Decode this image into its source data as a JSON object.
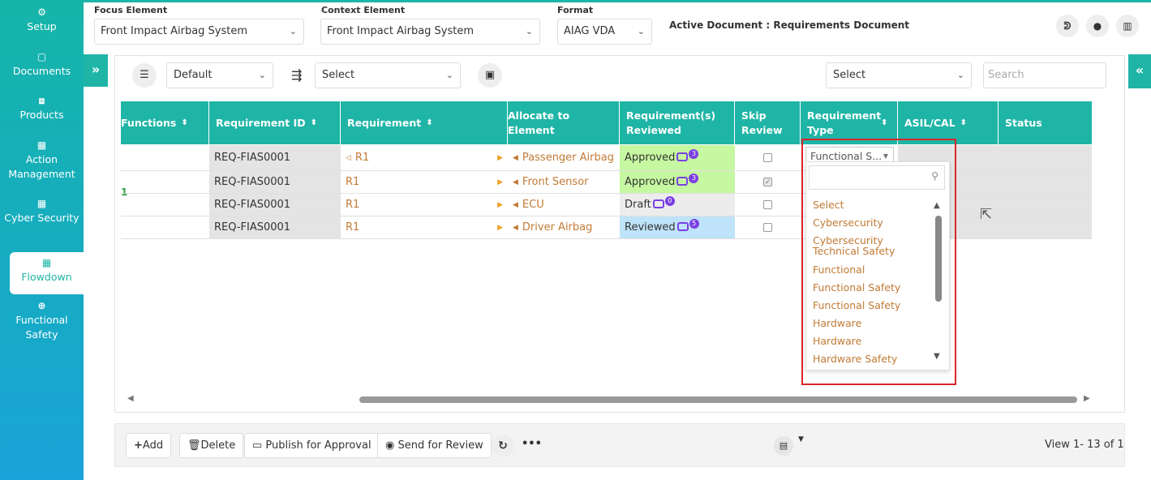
{
  "sidebar": {
    "items": [
      {
        "label": "Setup",
        "icon": "gears-icon",
        "glyph": "⚙"
      },
      {
        "label": "Documents",
        "icon": "document-icon",
        "glyph": "▢"
      },
      {
        "label": "Products",
        "icon": "product-icon",
        "glyph": "⧈"
      },
      {
        "label": "Action Management",
        "icon": "building-icon",
        "glyph": "▦"
      },
      {
        "label": "Cyber Security",
        "icon": "building-icon",
        "glyph": "▦"
      },
      {
        "label": "Flowdown",
        "icon": "building-icon",
        "glyph": "▦"
      },
      {
        "label": "Functional Safety",
        "icon": "shield-icon",
        "glyph": "⊕"
      }
    ],
    "active": "Flowdown"
  },
  "header": {
    "focus_label": "Focus Element",
    "focus_value": "Front Impact Airbag System",
    "context_label": "Context Element",
    "context_value": "Front Impact Airbag System",
    "format_label": "Format",
    "format_value": "AIAG VDA",
    "active_doc": "Active Document : Requirements Document"
  },
  "toolbar": {
    "view_value": "Default",
    "flow_select": "Select",
    "right_select": "Select",
    "search_placeholder": "Search"
  },
  "grid": {
    "columns": [
      "Functions",
      "Requirement ID",
      "Requirement",
      "Allocate to Element",
      "Requirement(s) Reviewed",
      "Skip Review",
      "Requirement Type",
      "ASIL/CAL",
      "Status"
    ],
    "function_value": "1",
    "rows": [
      {
        "id": "REQ-FIAS0001",
        "req": "R1",
        "alloc": "Passenger Airbag",
        "review": "Approved",
        "count": "3",
        "skip": false
      },
      {
        "id": "REQ-FIAS0001",
        "req": "R1",
        "alloc": "Front Sensor",
        "review": "Approved",
        "count": "3",
        "skip": true
      },
      {
        "id": "REQ-FIAS0001",
        "req": "R1",
        "alloc": "ECU",
        "review": "Draft",
        "count": "0",
        "skip": false
      },
      {
        "id": "REQ-FIAS0001",
        "req": "R1",
        "alloc": "Driver Airbag",
        "review": "Reviewed",
        "count": "5",
        "skip": false
      }
    ],
    "req_type_value": "Functional S..."
  },
  "dropdown": {
    "options": [
      "Select",
      "Cybersecurity",
      "Cybersecurity Technical Safety",
      "Functional",
      "Functional Safety",
      "Functional Safety",
      "Hardware",
      "Hardware",
      "Hardware Safety"
    ]
  },
  "footer": {
    "add": "Add",
    "delete": "Delete",
    "publish": "Publish for Approval",
    "send": "Send for Review",
    "view_count": "View 1- 13 of 1"
  },
  "colors": {
    "accent": "#1fb5a6",
    "approved": "#c6f7a1",
    "reviewed": "#bfe3f8",
    "link": "#c27a35",
    "highlight": "#d9262c",
    "badge": "#7b3fe4"
  }
}
